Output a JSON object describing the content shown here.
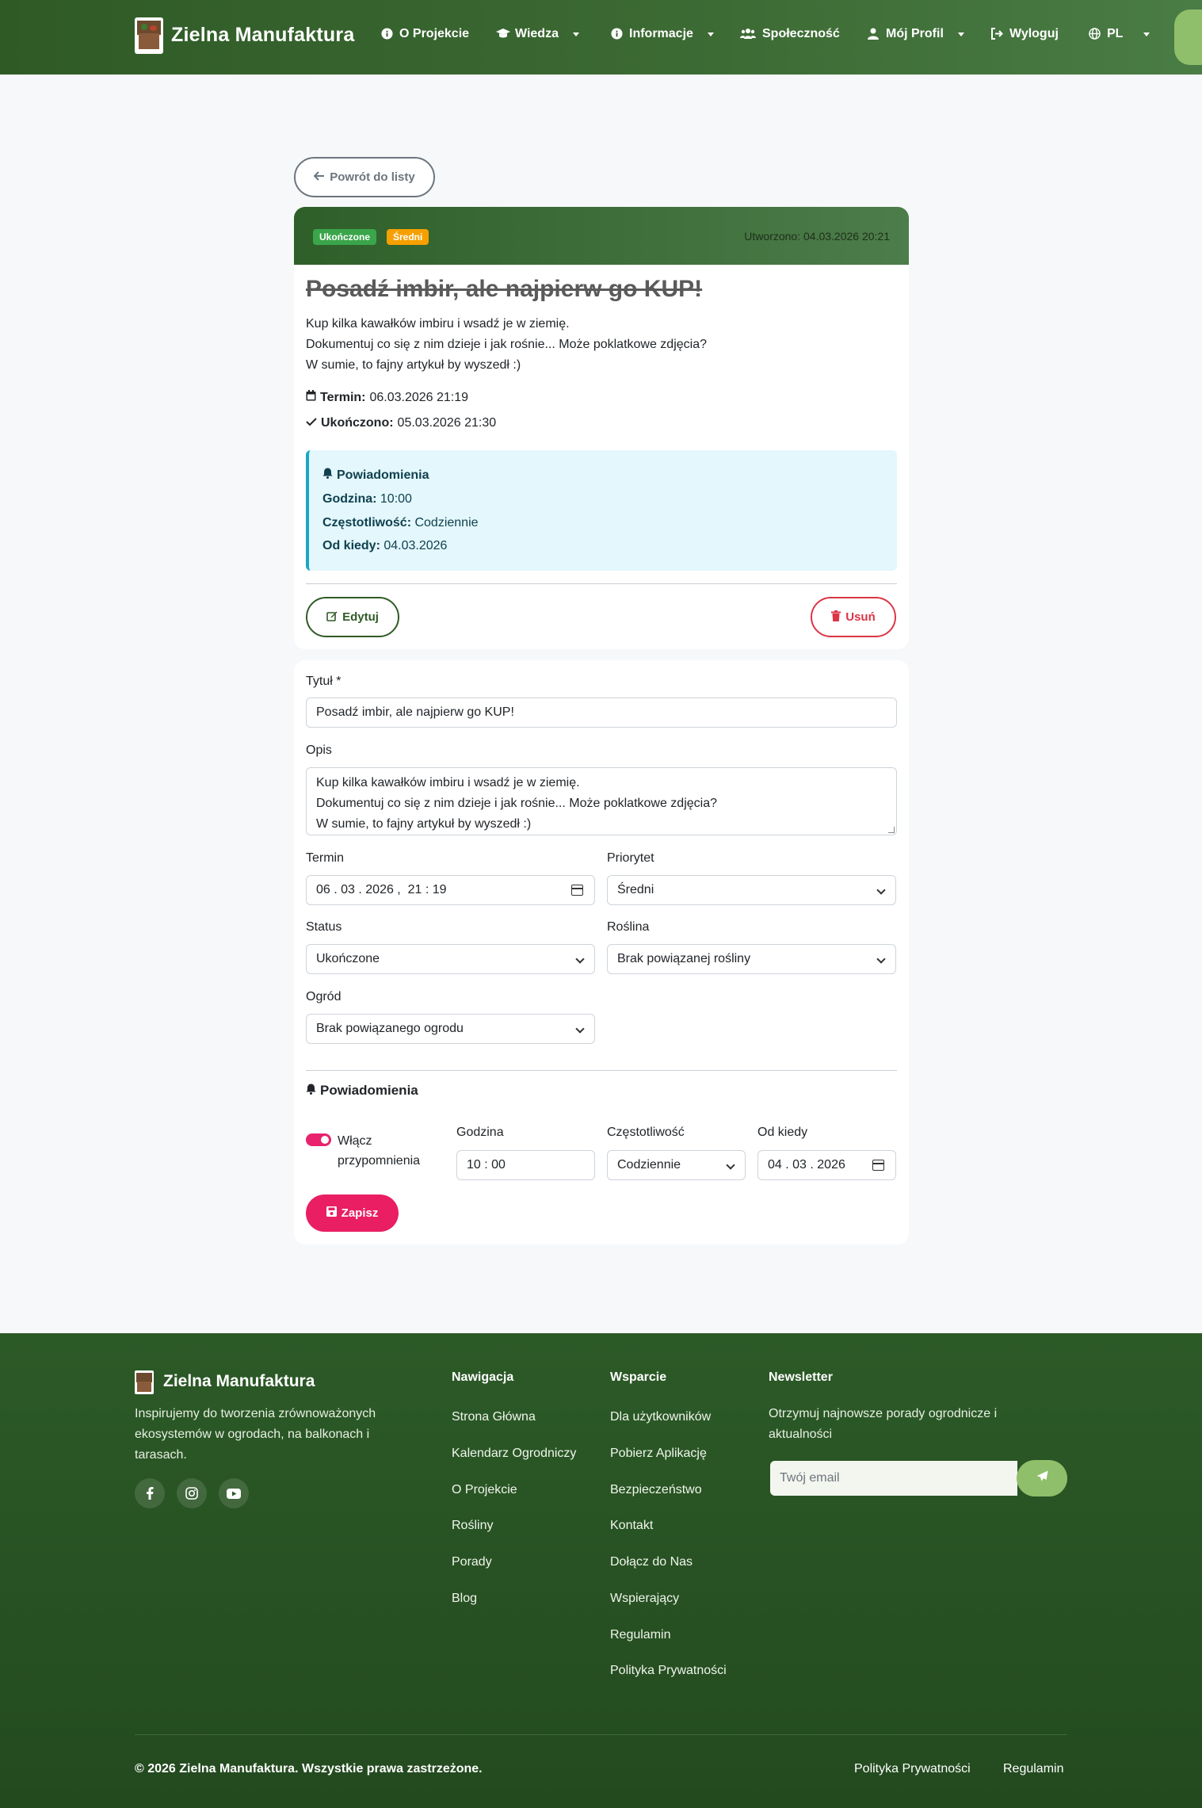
{
  "navbar": {
    "brand": "Zielna Manufaktura",
    "items": [
      {
        "label": "O Projekcie",
        "icon": "info-circle-icon"
      },
      {
        "label": "Wiedza",
        "icon": "graduation-cap-icon"
      },
      {
        "label": "Informacje",
        "icon": "info-circle-icon"
      },
      {
        "label": "Społeczność",
        "icon": "users-icon"
      },
      {
        "label": "Mój Profil",
        "icon": "user-icon"
      },
      {
        "label": "Wyloguj",
        "icon": "sign-out-icon"
      },
      {
        "label": "PL",
        "icon": "globe-icon"
      }
    ]
  },
  "back_label": "Powrót do listy",
  "task": {
    "status_badge": "Ukończone",
    "priority_badge": "Średni",
    "created": "Utworzono: 04.03.2026 20:21",
    "title": "Posadź imbir, ale najpierw go KUP!",
    "description_lines": [
      "Kup kilka kawałków imbiru i wsadź je w ziemię.",
      "Dokumentuj co się z nim dzieje i jak rośnie... Może poklatkowe zdjęcia?",
      "W sumie, to fajny artykuł by wyszedł :)"
    ],
    "deadline_label": "Termin:",
    "deadline_value": "06.03.2026 21:19",
    "completed_label": "Ukończono:",
    "completed_value": "05.03.2026 21:30",
    "notifications": {
      "title": "Powiadomienia",
      "time_label": "Godzina:",
      "time_value": "10:00",
      "freq_label": "Częstotliwość:",
      "freq_value": "Codziennie",
      "since_label": "Od kiedy:",
      "since_value": "04.03.2026"
    },
    "edit_label": "Edytuj",
    "delete_label": "Usuń"
  },
  "form": {
    "title_label": "Tytuł *",
    "title_value": "Posadź imbir, ale najpierw go KUP!",
    "desc_label": "Opis",
    "desc_lines": [
      "Kup kilka kawałków imbiru i wsadź je w ziemię.",
      "Dokumentuj co się z nim dzieje i jak rośnie... Może poklatkowe zdjęcia?",
      "W sumie, to fajny artykuł by wyszedł :)"
    ],
    "deadline_label": "Termin",
    "deadline_value": "06 . 03 . 2026 ,  21 : 19",
    "priority_label": "Priorytet",
    "priority_value": "Średni",
    "status_label": "Status",
    "status_value": "Ukończone",
    "plant_label": "Roślina",
    "plant_value": "Brak powiązanej rośliny",
    "garden_label": "Ogród",
    "garden_value": "Brak powiązanego ogrodu",
    "notif_section_title": "Powiadomienia",
    "toggle_label_1": "Włącz",
    "toggle_label_2": "przypomnienia",
    "hour_label": "Godzina",
    "hour_value": "10 : 00",
    "freq_label": "Częstotliwość",
    "freq_value": "Codziennie",
    "since_label": "Od kiedy",
    "since_value": "04 . 03 . 2026",
    "save_label": "Zapisz"
  },
  "footer": {
    "brand": "Zielna Manufaktura",
    "about": "Inspirujemy do tworzenia zrównoważonych ekosystemów w ogrodach, na balkonach i tarasach.",
    "nav_title": "Nawigacja",
    "nav_links": [
      "Strona Główna",
      "Kalendarz Ogrodniczy",
      "O Projekcie",
      "Rośliny",
      "Porady",
      "Blog"
    ],
    "support_title": "Wsparcie",
    "support_links": [
      "Dla użytkowników",
      "Pobierz Aplikację",
      "Bezpieczeństwo",
      "Kontakt",
      "Dołącz do Nas",
      "Wspierający",
      "Regulamin",
      "Polityka Prywatności"
    ],
    "newsletter_title": "Newsletter",
    "newsletter_text": "Otrzymuj najnowsze porady ogrodnicze i aktualności",
    "email_placeholder": "Twój email",
    "copyright": "© 2026 Zielna Manufaktura. Wszystkie prawa zastrzeżone.",
    "bottom_links": [
      "Polityka Prywatności",
      "Regulamin"
    ]
  },
  "colors": {
    "brand_green": "#2f5a26",
    "accent_pink": "#e91e63",
    "danger": "#dc3545",
    "info_bg": "#e3f7fc"
  }
}
